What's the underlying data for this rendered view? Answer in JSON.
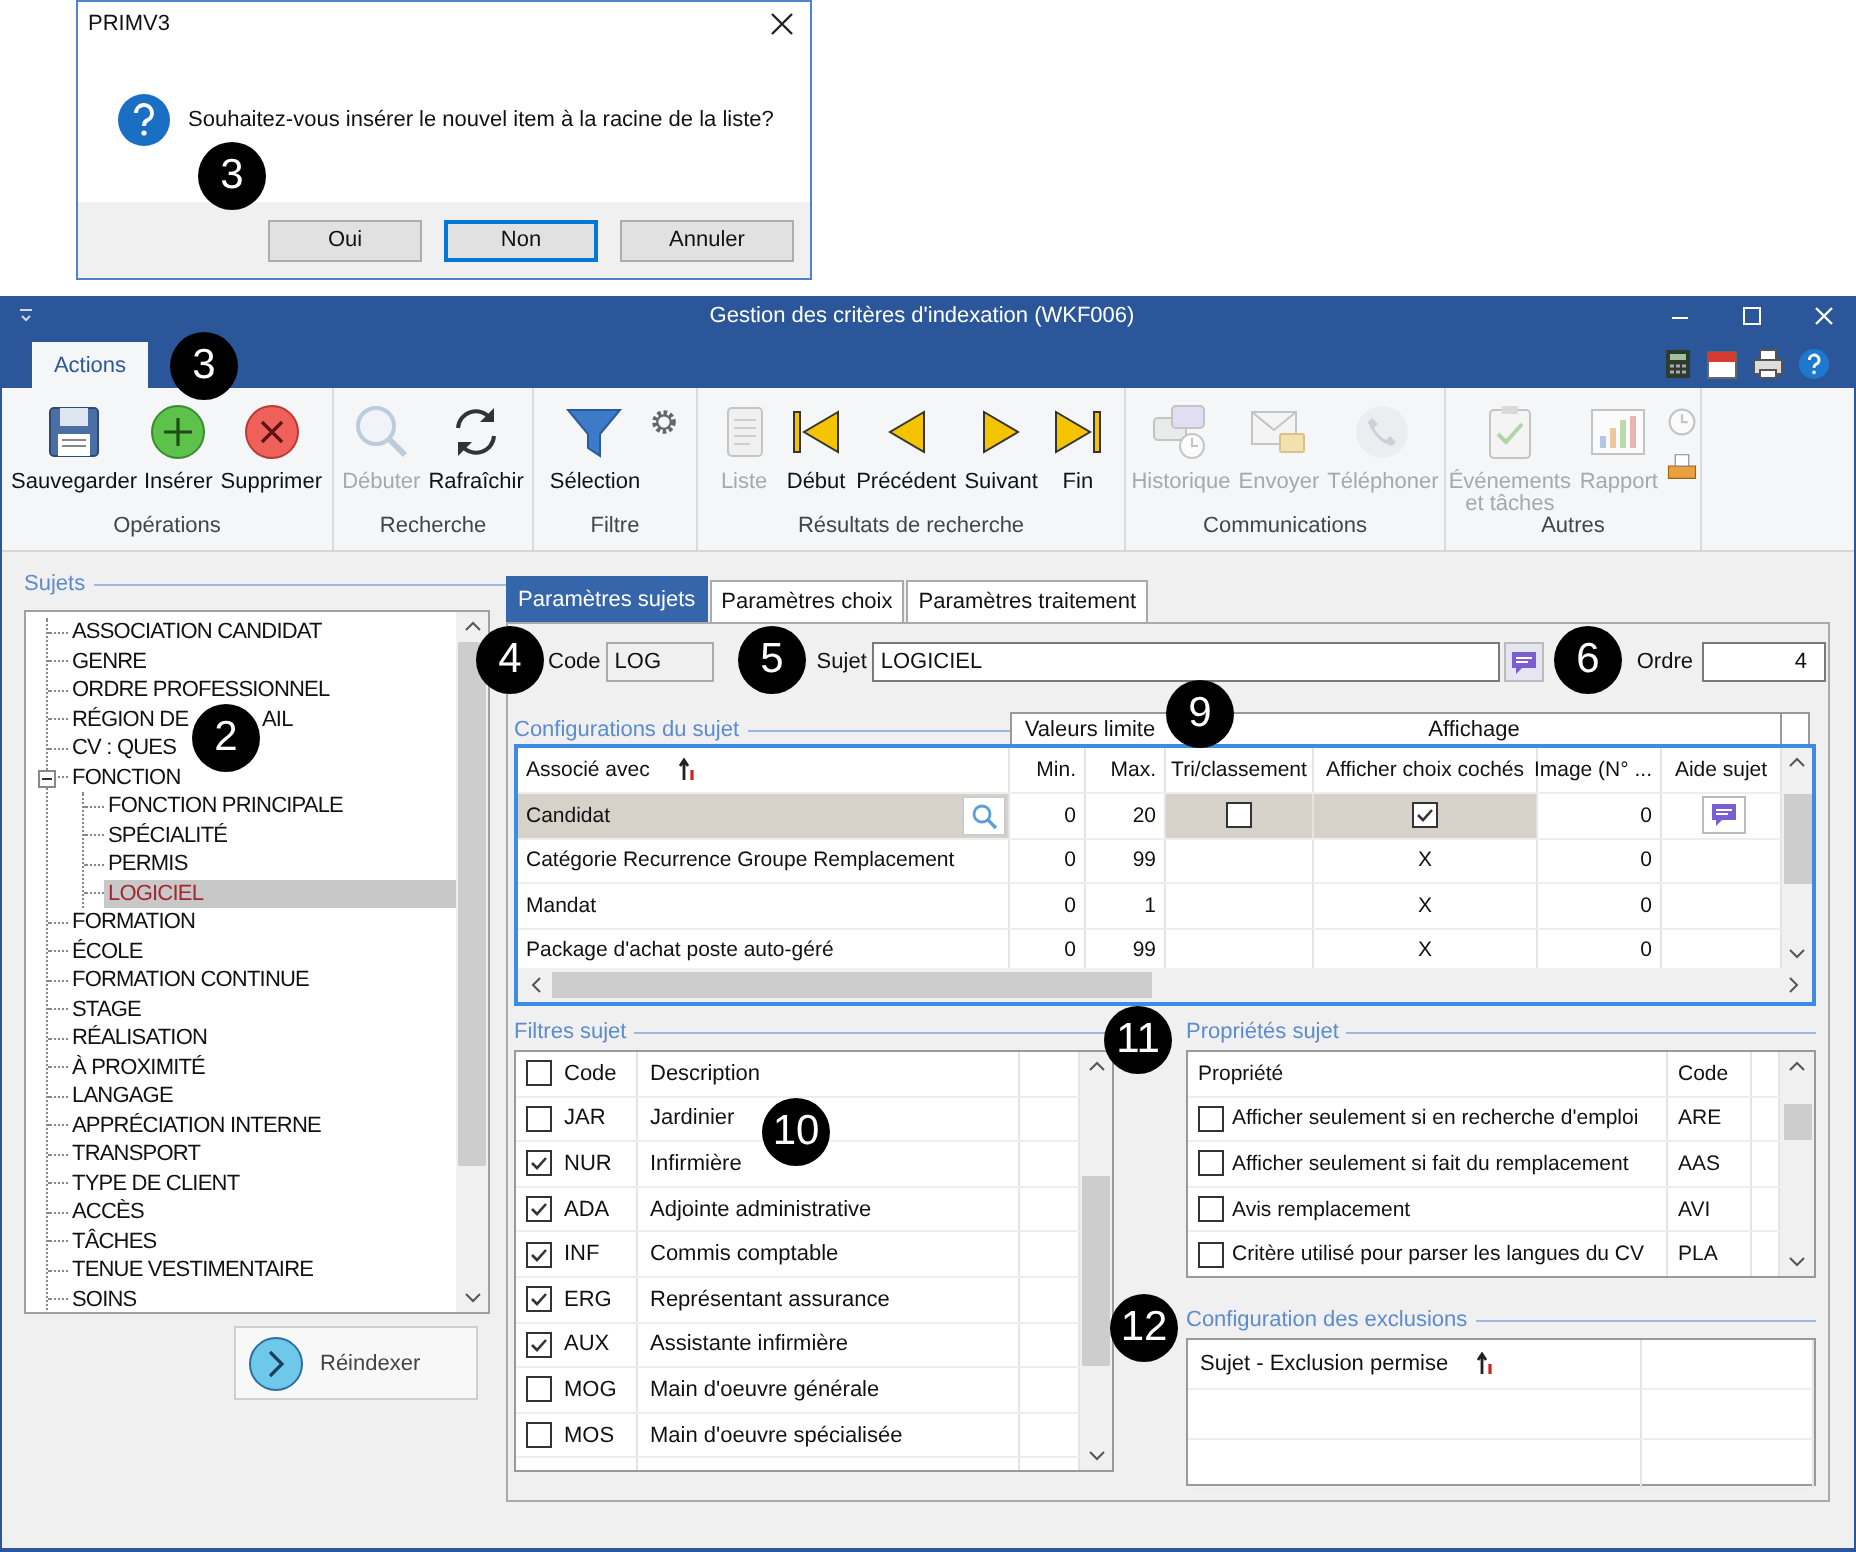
{
  "dialog": {
    "title": "PRIMV3",
    "message": "Souhaitez-vous insérer le nouvel item à la racine de la liste?",
    "buttons": [
      {
        "label": "Oui",
        "selected": false
      },
      {
        "label": "Non",
        "selected": true
      },
      {
        "label": "Annuler",
        "selected": false
      }
    ]
  },
  "window": {
    "title": "Gestion des critères d'indexation (WKF006)"
  },
  "ribbon": {
    "tabs": [
      {
        "label": "Actions",
        "selected": true
      }
    ],
    "groups": [
      {
        "label": "Opérations",
        "buttons": [
          {
            "kind": "save",
            "label": "Sauvegarder",
            "disabled": false
          },
          {
            "kind": "add",
            "label": "Insérer",
            "disabled": false
          },
          {
            "kind": "delete",
            "label": "Supprimer",
            "disabled": false
          }
        ]
      },
      {
        "label": "Recherche",
        "buttons": [
          {
            "kind": "search",
            "label": "Débuter",
            "disabled": true
          },
          {
            "kind": "refresh",
            "label": "Rafraîchir",
            "disabled": false
          }
        ]
      },
      {
        "label": "Filtre",
        "buttons": [
          {
            "kind": "filter",
            "label": "Sélection",
            "disabled": false
          }
        ],
        "small": [
          {
            "kind": "gear",
            "disabled": false
          }
        ]
      },
      {
        "label": "Résultats de recherche",
        "buttons": [
          {
            "kind": "list",
            "label": "Liste",
            "disabled": true
          },
          {
            "kind": "first",
            "label": "Début",
            "disabled": false
          },
          {
            "kind": "prev",
            "label": "Précédent",
            "disabled": false
          },
          {
            "kind": "next",
            "label": "Suivant",
            "disabled": false
          },
          {
            "kind": "last",
            "label": "Fin",
            "disabled": false
          }
        ]
      },
      {
        "label": "Communications",
        "buttons": [
          {
            "kind": "history",
            "label": "Historique",
            "disabled": true
          },
          {
            "kind": "send",
            "label": "Envoyer",
            "disabled": true
          },
          {
            "kind": "phone",
            "label": "Téléphoner",
            "disabled": true
          }
        ]
      },
      {
        "label": "Autres",
        "buttons": [
          {
            "kind": "events",
            "label": "Événements et tâches",
            "disabled": true
          },
          {
            "kind": "report",
            "label": "Rapport",
            "disabled": true
          }
        ],
        "small": [
          {
            "kind": "clock",
            "disabled": true
          },
          {
            "kind": "tray",
            "disabled": false
          }
        ]
      }
    ]
  },
  "sujets": {
    "label": "Sujets",
    "tree": [
      {
        "label": "ASSOCIATION CANDIDAT",
        "selected": false
      },
      {
        "label": "GENRE",
        "selected": false
      },
      {
        "label": "ORDRE PROFESSIONNEL",
        "selected": false
      },
      {
        "label": "RÉGION DE",
        "label_end": "AIL",
        "selected": false
      },
      {
        "label": "CV : QUES",
        "selected": false
      },
      {
        "label": "FONCTION",
        "selected": false,
        "expanded": true,
        "children": [
          {
            "label": "FONCTION PRINCIPALE",
            "selected": false
          },
          {
            "label": "SPÉCIALITÉ",
            "selected": false
          },
          {
            "label": "PERMIS",
            "selected": false
          },
          {
            "label": "LOGICIEL",
            "selected": true
          }
        ]
      },
      {
        "label": "FORMATION",
        "selected": false
      },
      {
        "label": "ÉCOLE",
        "selected": false
      },
      {
        "label": "FORMATION CONTINUE",
        "selected": false
      },
      {
        "label": "STAGE",
        "selected": false
      },
      {
        "label": "RÉALISATION",
        "selected": false
      },
      {
        "label": "À PROXIMITÉ",
        "selected": false
      },
      {
        "label": "LANGAGE",
        "selected": false
      },
      {
        "label": "APPRÉCIATION INTERNE",
        "selected": false
      },
      {
        "label": "TRANSPORT",
        "selected": false
      },
      {
        "label": "TYPE DE CLIENT",
        "selected": false
      },
      {
        "label": "ACCÈS",
        "selected": false
      },
      {
        "label": "TÂCHES",
        "selected": false
      },
      {
        "label": "TENUE VESTIMENTAIRE",
        "selected": false
      },
      {
        "label": "SOINS",
        "selected": false
      }
    ]
  },
  "reindex_button": {
    "label": "Réindexer"
  },
  "tabs": [
    {
      "label": "Paramètres sujets",
      "selected": true
    },
    {
      "label": "Paramètres choix",
      "selected": false
    },
    {
      "label": "Paramètres traitement",
      "selected": false
    }
  ],
  "code_field": {
    "label": "Code",
    "value": "LOG",
    "disabled": true
  },
  "sujet_field": {
    "label": "Sujet",
    "value": "LOGICIEL"
  },
  "ordre_field": {
    "label": "Ordre",
    "value": "4"
  },
  "configurations": {
    "label": "Configurations du sujet",
    "bands": [
      "Valeurs limite",
      "Affichage"
    ],
    "columns": [
      "Associé avec",
      "Min.",
      "Max.",
      "Tri/classement",
      "Afficher choix cochés",
      "Image (N° ...",
      "Aide sujet"
    ],
    "rows": [
      {
        "kind": "edit",
        "selected": true,
        "name": "Candidat",
        "min": "0",
        "max": "20",
        "sort_checked": false,
        "show_checked": true,
        "image": "0"
      },
      {
        "kind": "text",
        "selected": false,
        "name": "Catégorie Recurrence Groupe Remplacement",
        "min": "0",
        "max": "99",
        "show": "X",
        "image": "0"
      },
      {
        "kind": "text",
        "selected": false,
        "name": "Mandat",
        "min": "0",
        "max": "1",
        "show": "X",
        "image": "0"
      },
      {
        "kind": "text",
        "selected": false,
        "name": "Package d'achat poste auto-géré",
        "min": "0",
        "max": "99",
        "show": "X",
        "image": "0"
      }
    ]
  },
  "filtres": {
    "label": "Filtres sujet",
    "header_checked": false,
    "columns": [
      "Code",
      "Description"
    ],
    "rows": [
      {
        "checked": false,
        "code": "JAR",
        "description": "Jardinier"
      },
      {
        "checked": true,
        "code": "NUR",
        "description": "Infirmière"
      },
      {
        "checked": true,
        "code": "ADA",
        "description": "Adjointe administrative"
      },
      {
        "checked": true,
        "code": "INF",
        "description": "Commis comptable"
      },
      {
        "checked": true,
        "code": "ERG",
        "description": "Représentant assurance"
      },
      {
        "checked": true,
        "code": "AUX",
        "description": "Assistante infirmière"
      },
      {
        "checked": false,
        "code": "MOG",
        "description": "Main d'oeuvre générale"
      },
      {
        "checked": false,
        "code": "MOS",
        "description": "Main d'oeuvre spécialisée"
      }
    ]
  },
  "proprietes": {
    "label": "Propriétés sujet",
    "columns": [
      "Propriété",
      "Code"
    ],
    "rows": [
      {
        "checked": false,
        "label": "Afficher seulement si en recherche d'emploi",
        "code": "ARE"
      },
      {
        "checked": false,
        "label": "Afficher seulement si fait du remplacement",
        "code": "AAS"
      },
      {
        "checked": false,
        "label": "Avis remplacement",
        "code": "AVI"
      },
      {
        "checked": false,
        "label": "Critère utilisé pour parser les langues du CV",
        "code": "PLA"
      }
    ]
  },
  "exclusions": {
    "label": "Configuration des exclusions",
    "columns": [
      "Sujet - Exclusion permise"
    ]
  },
  "callouts": [
    "3",
    "3",
    "2",
    "4",
    "5",
    "6",
    "9",
    "10",
    "11",
    "12"
  ]
}
